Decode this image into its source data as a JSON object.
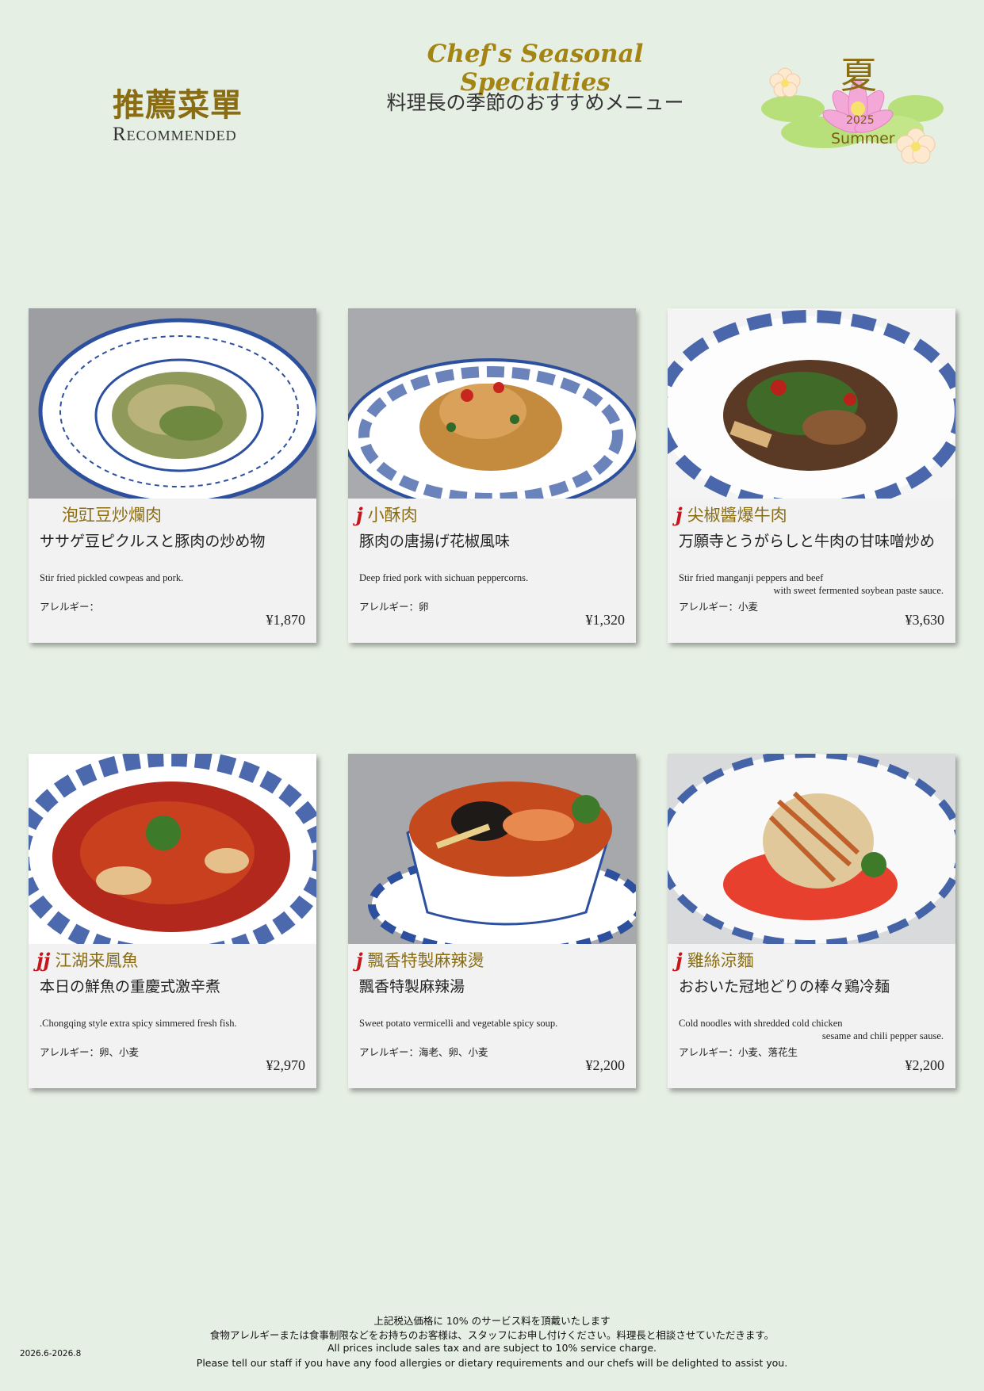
{
  "header": {
    "title_cn": "推薦菜單",
    "title_en": "Recommended",
    "title": "Chef's Seasonal Specialties",
    "subtitle": "料理長の季節のおすすめメニュー",
    "season_kanji": "夏",
    "season_year": "2025",
    "season_name": "Summer"
  },
  "menu": [
    {
      "name_cn": "泡豇豆炒爛肉",
      "spice": "",
      "name_jp": "ササゲ豆ピクルスと豚肉の炒め物",
      "desc_en": "Stir fried pickled cowpeas and pork.",
      "desc_en_2": "",
      "allergy": "アレルギー：",
      "price": "¥1,870"
    },
    {
      "name_cn": "小酥肉",
      "spice": "j",
      "name_jp": "豚肉の唐揚げ花椒風味",
      "desc_en": "Deep fried pork with sichuan peppercorns.",
      "desc_en_2": "",
      "allergy": "アレルギー：卵",
      "price": "¥1,320"
    },
    {
      "name_cn": "尖椒醬爆牛肉",
      "spice": "j",
      "name_jp": "万願寺とうがらしと牛肉の甘味噌炒め",
      "desc_en": "Stir fried manganji peppers and beef",
      "desc_en_2": "with sweet fermented soybean paste sauce.",
      "allergy": "アレルギー：小麦",
      "price": "¥3,630"
    },
    {
      "name_cn": "江湖来鳳魚",
      "spice": "jj",
      "name_jp": "本日の鮮魚の重慶式激辛煮",
      "desc_en": ".Chongqing style extra spicy simmered fresh fish.",
      "desc_en_2": "",
      "allergy": "アレルギー：卵、小麦",
      "price": "¥2,970"
    },
    {
      "name_cn": "飄香特製麻辣燙",
      "spice": "j",
      "name_jp": "飄香特製麻辣湯",
      "desc_en": "Sweet potato vermicelli and vegetable spicy soup.",
      "desc_en_2": "",
      "allergy": "アレルギー：海老、卵、小麦",
      "price": "¥2,200"
    },
    {
      "name_cn": "雞絲涼麵",
      "spice": "j",
      "name_jp": "おおいた冠地どりの棒々鶏冷麺",
      "desc_en": "Cold noodles with shredded cold chicken",
      "desc_en_2": "sesame and chili pepper sause.",
      "allergy": "アレルギー：小麦、落花生",
      "price": "¥2,200"
    }
  ],
  "footer": {
    "line1": "上記税込価格に 10% のサービス料を頂戴いたします",
    "line2": "食物アレルギーまたは食事制限などをお持ちのお客様は、スタッフにお申し付けください。料理長と相談させていただきます。",
    "line3": "All prices include sales tax and are subject to 10% service charge.",
    "line4": "Please tell our staff if you have any food allergies or dietary requirements and our chefs will be delighted to assist you.",
    "period": "2026.6-2026.8"
  },
  "colors": {
    "accent": "#8a6d12",
    "chili": "#c4161c",
    "background": "#e6efe4"
  }
}
